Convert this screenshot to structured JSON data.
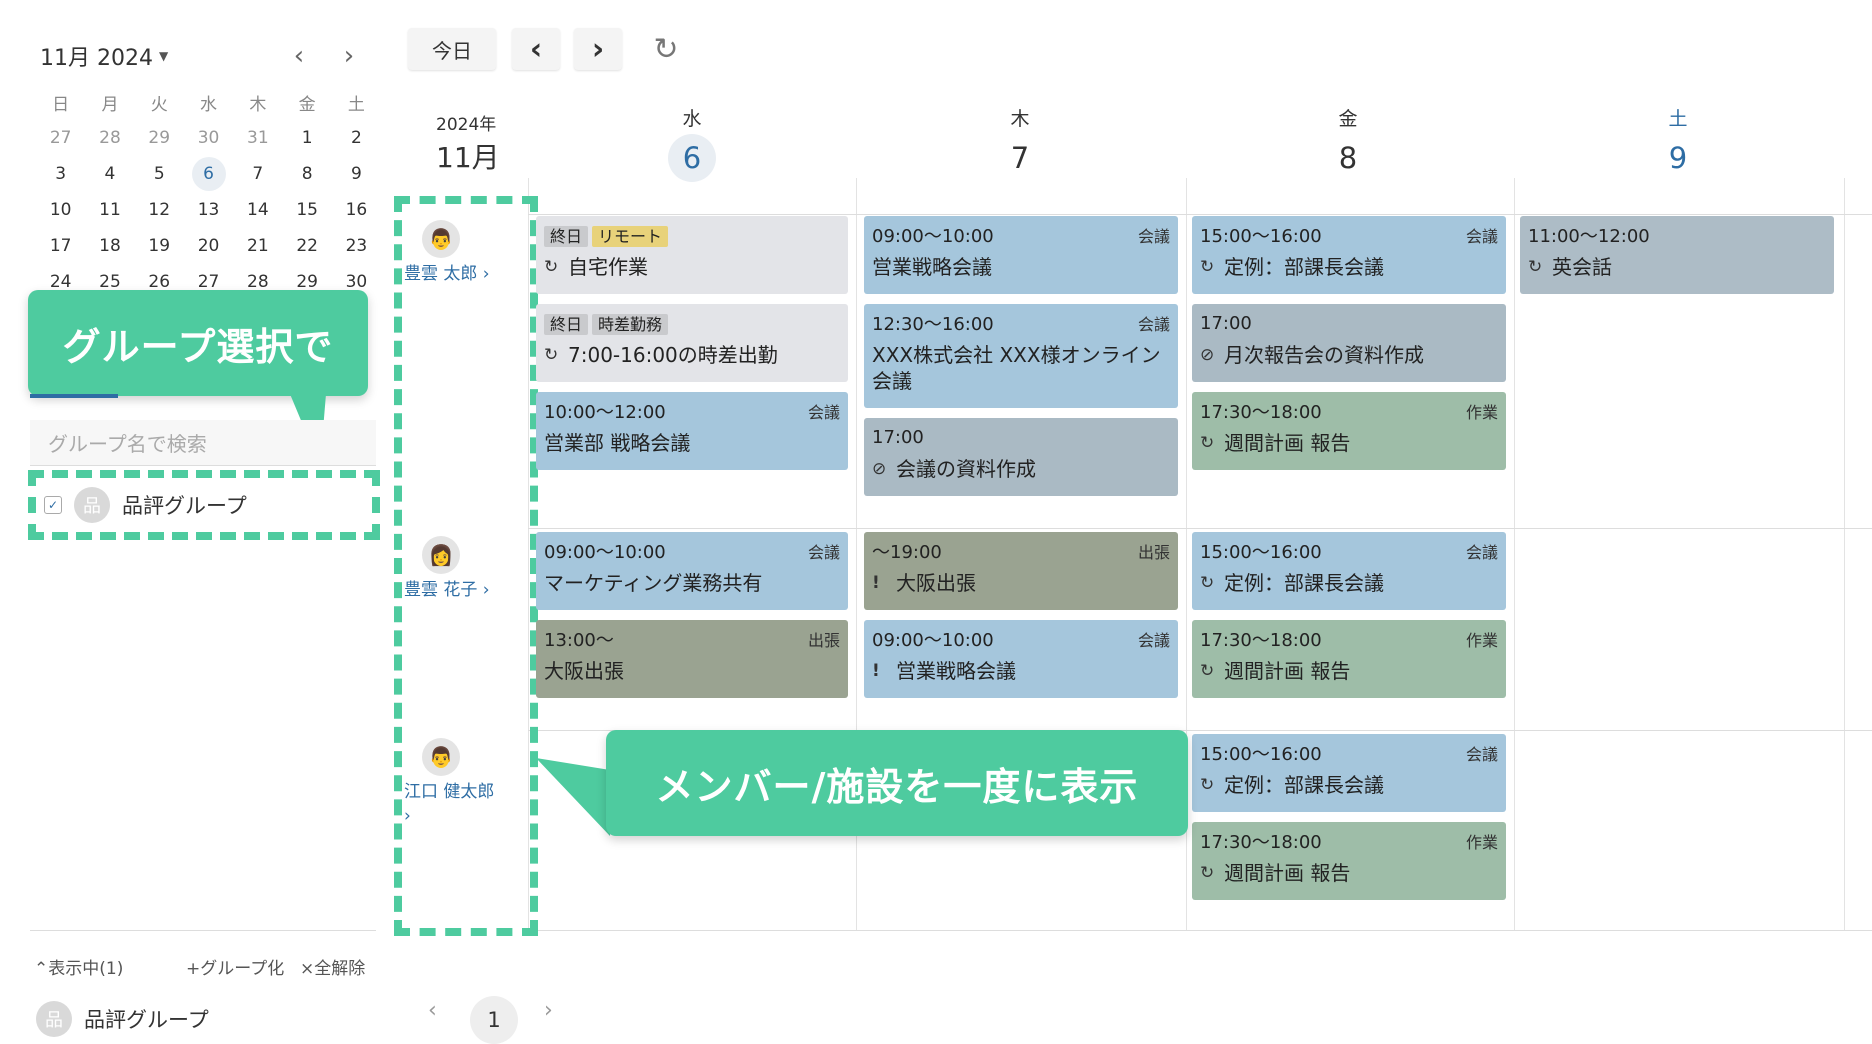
{
  "mini_calendar": {
    "title": "11月 2024",
    "weekdays": [
      "日",
      "月",
      "火",
      "水",
      "木",
      "金",
      "土"
    ],
    "weeks": [
      [
        "27",
        "28",
        "29",
        "30",
        "31",
        "1",
        "2"
      ],
      [
        "3",
        "4",
        "5",
        "6",
        "7",
        "8",
        "9"
      ],
      [
        "10",
        "11",
        "12",
        "13",
        "14",
        "15",
        "16"
      ],
      [
        "17",
        "18",
        "19",
        "20",
        "21",
        "22",
        "23"
      ],
      [
        "24",
        "25",
        "26",
        "27",
        "28",
        "29",
        "30"
      ]
    ],
    "selected_day": "6"
  },
  "callouts": {
    "group": "グループ選択で",
    "members": "メンバー/施設を一度に表示"
  },
  "group_panel": {
    "search_placeholder": "グループ名で検索",
    "group_name": "品評グループ",
    "check_mark": "✓",
    "footer_showing": "⌃表示中(1)",
    "footer_group": "+グループ化",
    "footer_clear": "×全解除",
    "footer_group_name": "品評グループ",
    "group_icon_glyph": "品"
  },
  "toolbar": {
    "today_label": "今日",
    "prev_glyph": "‹",
    "next_glyph": "›",
    "refresh_glyph": "↻"
  },
  "header": {
    "year": "2024年",
    "month": "11月",
    "days": [
      {
        "dow": "水",
        "num": "6"
      },
      {
        "dow": "木",
        "num": "7"
      },
      {
        "dow": "金",
        "num": "8"
      },
      {
        "dow": "土",
        "num": "9"
      }
    ]
  },
  "members": [
    {
      "name": "豊雲 太郎 ›",
      "avatar": "👨"
    },
    {
      "name": "豊雲 花子 ›",
      "avatar": "👩"
    },
    {
      "name": "江口 健太郎 ›",
      "avatar": "👨"
    }
  ],
  "events": {
    "m1_wed_1": {
      "tags": [
        "終日",
        "リモート"
      ],
      "icon": "↻",
      "title": "自宅作業"
    },
    "m1_wed_2": {
      "tags": [
        "終日",
        "時差勤務"
      ],
      "icon": "↻",
      "title": "7:00-16:00の時差出勤"
    },
    "m1_wed_3": {
      "time": "10:00〜12:00",
      "cat": "会議",
      "title": "営業部 戦略会議"
    },
    "m1_thu_1": {
      "time": "09:00〜10:00",
      "cat": "会議",
      "title": "営業戦略会議"
    },
    "m1_thu_2": {
      "time": "12:30〜16:00",
      "cat": "会議",
      "title": "XXX株式会社 XXX様オンライン会議"
    },
    "m1_thu_3": {
      "time": "17:00",
      "icon": "⊘",
      "title": "会議の資料作成"
    },
    "m1_fri_1": {
      "time": "15:00〜16:00",
      "cat": "会議",
      "icon": "↻",
      "title": "定例：部課長会議"
    },
    "m1_fri_2": {
      "time": "17:00",
      "icon": "⊘",
      "title": "月次報告会の資料作成"
    },
    "m1_fri_3": {
      "time": "17:30〜18:00",
      "cat": "作業",
      "icon": "↻",
      "title": "週間計画 報告"
    },
    "m1_sat_1": {
      "time": "11:00〜12:00",
      "icon": "↻",
      "title": "英会話"
    },
    "m2_wed_1": {
      "time": "09:00〜10:00",
      "cat": "会議",
      "title": "マーケティング業務共有"
    },
    "m2_wed_2": {
      "time": "13:00〜",
      "cat": "出張",
      "title": "大阪出張"
    },
    "m2_thu_1": {
      "time": "〜19:00",
      "cat": "出張",
      "icon": "!",
      "title": "大阪出張"
    },
    "m2_thu_2": {
      "time": "09:00〜10:00",
      "cat": "会議",
      "icon": "!",
      "title": "営業戦略会議"
    },
    "m2_fri_1": {
      "time": "15:00〜16:00",
      "cat": "会議",
      "icon": "↻",
      "title": "定例：部課長会議"
    },
    "m2_fri_2": {
      "time": "17:30〜18:00",
      "cat": "作業",
      "icon": "↻",
      "title": "週間計画 報告"
    },
    "m3_fri_1": {
      "time": "15:00〜16:00",
      "cat": "会議",
      "icon": "↻",
      "title": "定例：部課長会議"
    },
    "m3_fri_2": {
      "time": "17:30〜18:00",
      "cat": "作業",
      "icon": "↻",
      "title": "週間計画 報告"
    }
  },
  "pager": {
    "prev": "‹",
    "current": "1",
    "next": "›"
  },
  "colors": {
    "accent": "#4ecb9f",
    "link": "#2e6da4",
    "meeting": "#a5c6dc",
    "task": "#9ebda8",
    "trip": "#9aa391",
    "todo": "#aabac4",
    "allday": "#e3e4e8",
    "tag_yellow": "#e8d27a",
    "tag_gray": "#c9cacd"
  }
}
